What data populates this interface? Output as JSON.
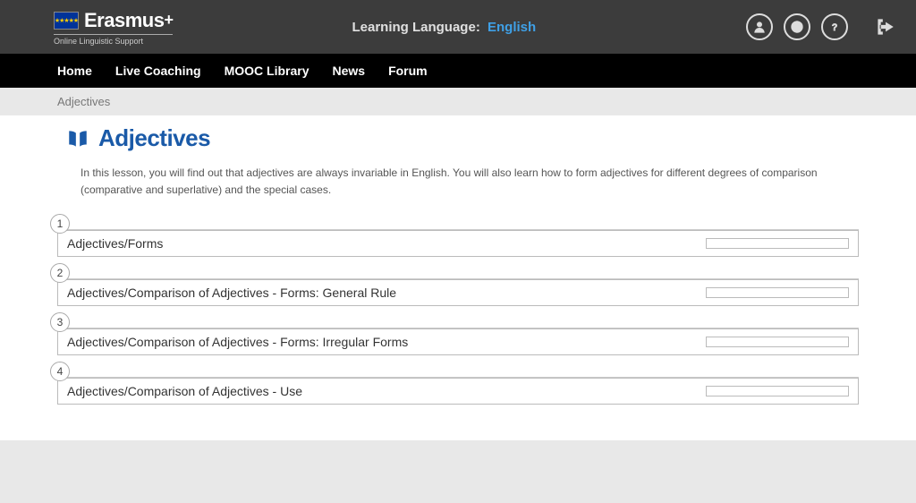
{
  "header": {
    "brand_name": "Erasmus",
    "brand_plus": "+",
    "brand_sub": "Online Linguistic Support",
    "language_label": "Learning Language:",
    "language_value": "English"
  },
  "nav": {
    "home": "Home",
    "live_coaching": "Live Coaching",
    "mooc": "MOOC Library",
    "news": "News",
    "forum": "Forum"
  },
  "breadcrumb": "Adjectives",
  "page": {
    "title": "Adjectives",
    "intro": "In this lesson, you will find out that adjectives are always invariable in English. You will also learn how to form adjectives for different degrees of comparison (comparative and superlative) and the special cases."
  },
  "lessons": [
    {
      "num": "1",
      "title": "Adjectives/Forms"
    },
    {
      "num": "2",
      "title": "Adjectives/Comparison of Adjectives - Forms: General Rule"
    },
    {
      "num": "3",
      "title": "Adjectives/Comparison of Adjectives - Forms: Irregular Forms"
    },
    {
      "num": "4",
      "title": "Adjectives/Comparison of Adjectives - Use"
    }
  ]
}
